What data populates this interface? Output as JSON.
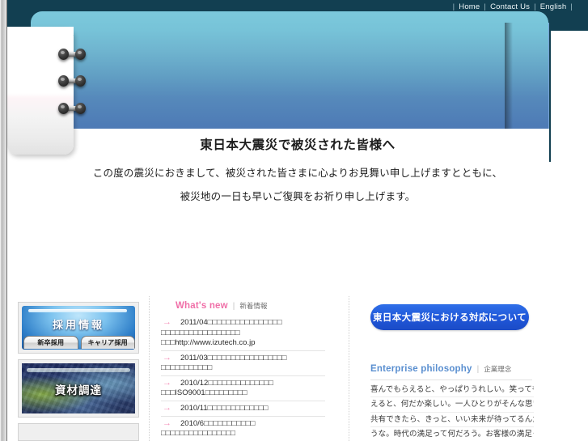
{
  "topnav": {
    "items": [
      {
        "label": "Home"
      },
      {
        "label": "Contact Us"
      },
      {
        "label": "English"
      }
    ],
    "separator": "|"
  },
  "quake_message": {
    "title": "東日本大震災で被災された皆様へ",
    "line1": "この度の震災におきまして、被災された皆さまに心よりお見舞い申し上げますとともに、",
    "line2": "被災地の一日も早いご復興をお祈り申し上げます。"
  },
  "sidebar": {
    "recruit": {
      "title": "採用情報",
      "tabs": [
        {
          "label": "新卒採用"
        },
        {
          "label": "キャリア採用"
        }
      ]
    },
    "material": {
      "title": "資材調達"
    }
  },
  "news": {
    "heading_en": "What's new",
    "heading_jp": "新着情報",
    "separator": "|",
    "arrow": "→",
    "items": [
      {
        "date": "2011/04",
        "text": "□□□□□□□□□□□□□□□□",
        "cont": "□□□□□□□□□□□□□□□□□",
        "cont2": "□□□http://www.izutech.co.jp"
      },
      {
        "date": "2011/03",
        "text": "□□□□□□□□□□□□□□□□□",
        "cont": "□□□□□□□□□□□"
      },
      {
        "date": "2010/12",
        "text": "□□□□□□□□□□□□□□",
        "cont": "□□□ISO9001□□□□□□□□□"
      },
      {
        "date": "2010/11",
        "text": "□□□□□□□□□□□□□"
      },
      {
        "date": "2010/6",
        "text": "□□□□□□□□□□□",
        "cont": "□□□□□□□□□□□□□□□□"
      }
    ]
  },
  "right": {
    "cta_label": "東日本大震災における対応について",
    "philosophy": {
      "heading_en": "Enterprise philosophy",
      "heading_jp": "企業理念",
      "separator": "|",
      "lines": [
        "喜んでもらえると、やっぱりうれしい。笑ってもら",
        "えると、何だか楽しい。一人ひとりがそんな思いを",
        "共有できたら、きっと、いい未来が待ってるんだろ",
        "うな。時代の満足って何だろう。お客様の満足って"
      ]
    }
  },
  "colors": {
    "navy": "#123f51",
    "banner_top": "#7cc9dc",
    "banner_bottom": "#4d7ab5",
    "banner_side": "#76a2d6",
    "pink": "#f06fa8",
    "blue_accent": "#5a8fd0",
    "cta_blue": "#1f56d8"
  }
}
